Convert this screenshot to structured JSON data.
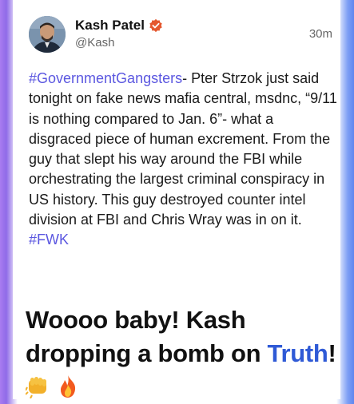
{
  "post": {
    "author_name": "Kash Patel",
    "handle": "@Kash",
    "time": "30m",
    "hashtag1": "#GovernmentGangsters",
    "body_main": "- Pter Strzok just said tonight on fake news mafia central, msdnc, “9/11 is nothing compared to Jan. 6”- what a disgraced piece of human excrement. From the guy that slept his way around the FBI while orchestrating the largest criminal conspiracy in US history. This guy destroyed counter intel division at FBI and Chris Wray was in on it.",
    "hashtag2": "#FWK"
  },
  "caption": {
    "text1": "Woooo baby! Kash dropping a bomb on",
    "highlight": "Truth",
    "text2": "!"
  },
  "colors": {
    "hashtag": "#5b57e0",
    "truth": "#2f5ad6",
    "verified": "#e4572e",
    "border_left": "#a97cf0",
    "border_right": "#5e86ef"
  },
  "icons": {
    "verified": "verified-badge-icon",
    "fist": "fist-bump-icon",
    "fire": "fire-icon"
  }
}
